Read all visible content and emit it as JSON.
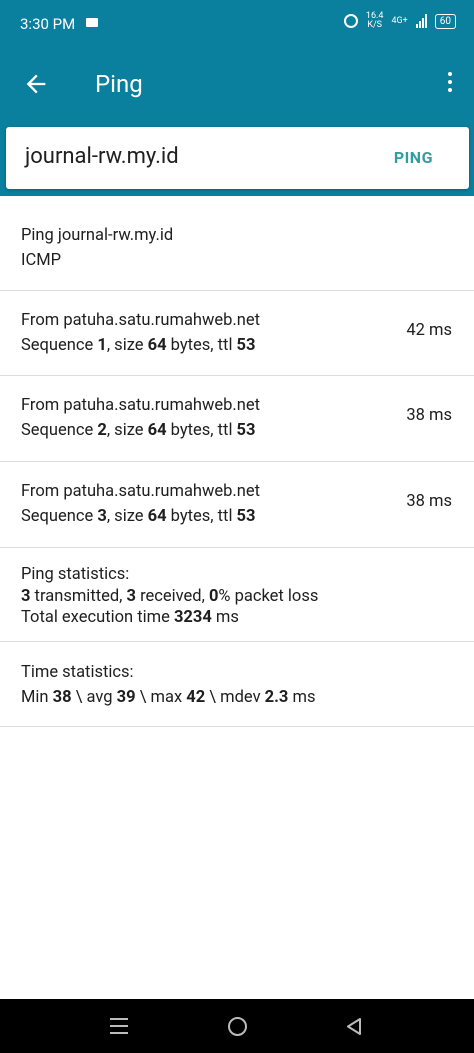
{
  "status": {
    "time": "3:30 PM",
    "speed_top": "16.4",
    "speed_bottom": "K/S",
    "network": "4G+",
    "battery": "60"
  },
  "appbar": {
    "title": "Ping",
    "back_icon": "arrow-back-icon",
    "menu_icon": "more-vert-icon"
  },
  "search": {
    "host": "journal-rw.my.id",
    "button": "PING"
  },
  "header_row": {
    "title": "Ping journal-rw.my.id",
    "protocol": "ICMP"
  },
  "replies": [
    {
      "from": "From patuha.satu.rumahweb.net",
      "seq_label": "Sequence ",
      "seq": "1",
      "size_label": ", size ",
      "size": "64",
      "ttl_label": " bytes, ttl ",
      "ttl": "53",
      "time": "42 ms"
    },
    {
      "from": "From patuha.satu.rumahweb.net",
      "seq_label": "Sequence ",
      "seq": "2",
      "size_label": ", size ",
      "size": "64",
      "ttl_label": " bytes, ttl ",
      "ttl": "53",
      "time": "38 ms"
    },
    {
      "from": "From patuha.satu.rumahweb.net",
      "seq_label": "Sequence ",
      "seq": "3",
      "size_label": ", size ",
      "size": "64",
      "ttl_label": " bytes, ttl ",
      "ttl": "53",
      "time": "38 ms"
    }
  ],
  "ping_stats": {
    "title": "Ping statistics:",
    "transmitted": "3",
    "transmitted_label": " transmitted, ",
    "received": "3",
    "received_label": " received, ",
    "loss": "0",
    "loss_label": "% packet loss",
    "exec_label": "Total execution time ",
    "exec_time": "3234",
    "exec_unit": " ms"
  },
  "time_stats": {
    "title": "Time statistics:",
    "min_label": "Min ",
    "min": "38",
    "avg_label": " \\ avg ",
    "avg": "39",
    "max_label": " \\ max ",
    "max": "42",
    "mdev_label": " \\ mdev ",
    "mdev": "2.3",
    "unit": " ms"
  },
  "colors": {
    "primary": "#0b7f9e",
    "accent": "#2f9e9e"
  }
}
